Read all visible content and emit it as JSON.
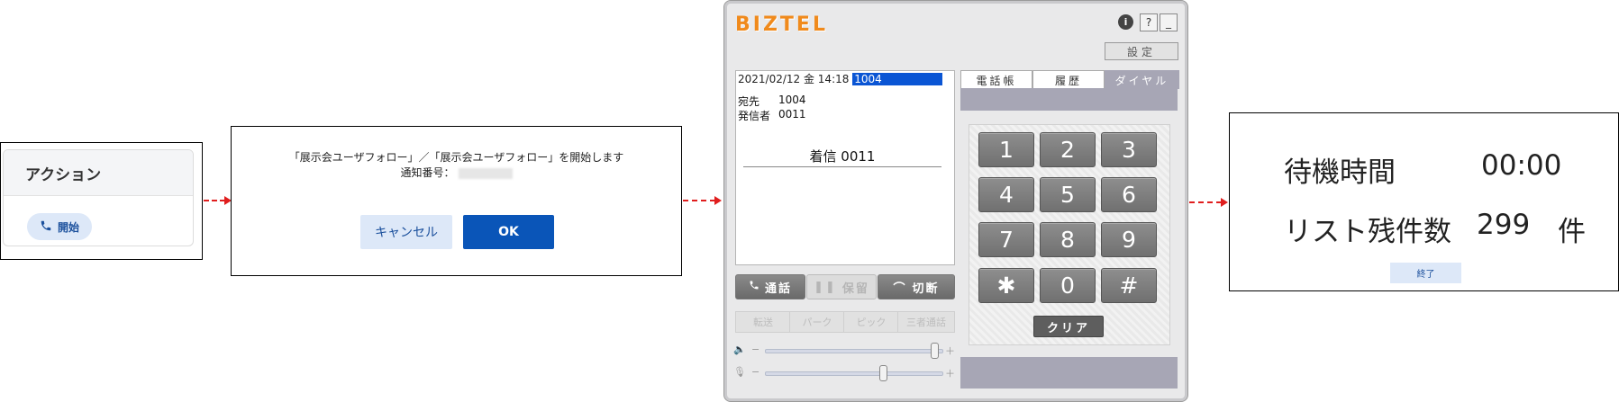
{
  "panel1": {
    "header": "アクション",
    "start_button": "開始"
  },
  "panel2": {
    "message_line1": "「展示会ユーザフォロー」／「展示会ユーザフォロー」を開始します",
    "message_line2_label": "通知番号：",
    "cancel_label": "キャンセル",
    "ok_label": "OK"
  },
  "biztel": {
    "logo": "BIZTEL",
    "info_label": "i",
    "help_label": "?",
    "minimize_label": "_",
    "settings_label": "設定",
    "datetime": "2021/02/12 金 14:18",
    "extension_highlight": "1004",
    "dest_label": "宛先",
    "dest_value": "1004",
    "caller_label": "発信者",
    "caller_value": "0011",
    "incoming": "着信 0011",
    "tabs": [
      "電話帳",
      "履歴",
      "ダイヤル"
    ],
    "call_label": "通話",
    "hold_label": "保留",
    "hangup_label": "切断",
    "sub_buttons": [
      "転送",
      "パーク",
      "ピック",
      "三者通話"
    ],
    "keys": [
      "1",
      "2",
      "3",
      "4",
      "5",
      "6",
      "7",
      "8",
      "9",
      "✱",
      "0",
      "#"
    ],
    "clear_label": "クリア"
  },
  "panel4": {
    "wait_label": "待機時間",
    "wait_value": "00:00",
    "remaining_label": "リスト残件数",
    "remaining_value": "299",
    "remaining_unit": "件",
    "end_label": "終了"
  },
  "colors": {
    "accent_blue": "#0a55b8",
    "light_blue": "#dde8f8",
    "arrow_red": "#e01e1e",
    "biztel_orange": "#f08a1c"
  }
}
